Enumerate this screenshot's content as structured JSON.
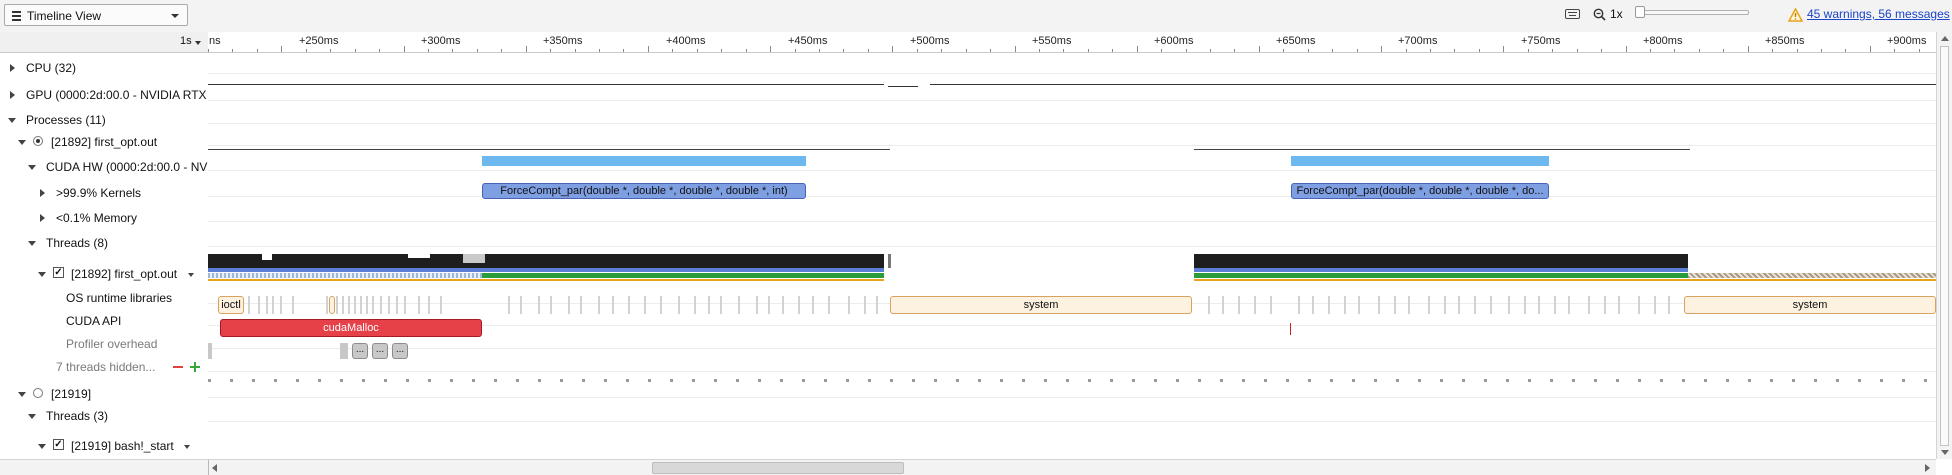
{
  "toolbar": {
    "view_selector": "Timeline View",
    "zoom_label": "1x",
    "warnings_link": "45 warnings, 56 messages"
  },
  "ruler": {
    "scale": "1s",
    "ticks": [
      "+250ms",
      "+300ms",
      "+350ms",
      "+400ms",
      "+450ms",
      "+500ms",
      "+550ms",
      "+600ms",
      "+650ms",
      "+700ms",
      "+750ms",
      "+800ms",
      "+850ms",
      "+900ms"
    ],
    "first_partial": "ns"
  },
  "tree": {
    "cpu": "CPU (32)",
    "gpu": "GPU (0000:2d:00.0 - NVIDIA RTX",
    "processes": "Processes (11)",
    "proc1": "[21892] first_opt.out",
    "cuda_hw": "CUDA HW (0000:2d:00.0 - NV",
    "kernels": ">99.9% Kernels",
    "memory": "<0.1% Memory",
    "threads": "Threads (8)",
    "thread1": "[21892] first_opt.out",
    "os_runtime": "OS runtime libraries",
    "cuda_api": "CUDA API",
    "profiler": "Profiler overhead",
    "hidden": "7 threads hidden...",
    "proc2": "[21919]",
    "threads2": "Threads (3)",
    "thread2": "[21919] bash!_start"
  },
  "timeline": {
    "kernel1": "ForceCompt_par(double *, double *, double *, double *, int)",
    "kernel2": "ForceCompt_par(double *, double *, double *, do...",
    "ioctl": "ioctl",
    "system1": "system",
    "system2": "system",
    "cudamalloc": "cudaMalloc",
    "ellipsis": "..."
  },
  "colors": {
    "kernel": "#7f9fe3",
    "kernel_bar": "#6cb8ef",
    "cuda_api": "#e64049",
    "system": "#fdf1e0",
    "thread_activity": "#1e1e1e",
    "green_band": "#2a9c3c",
    "warning": "#e8a31b",
    "link": "#1a44c9"
  }
}
